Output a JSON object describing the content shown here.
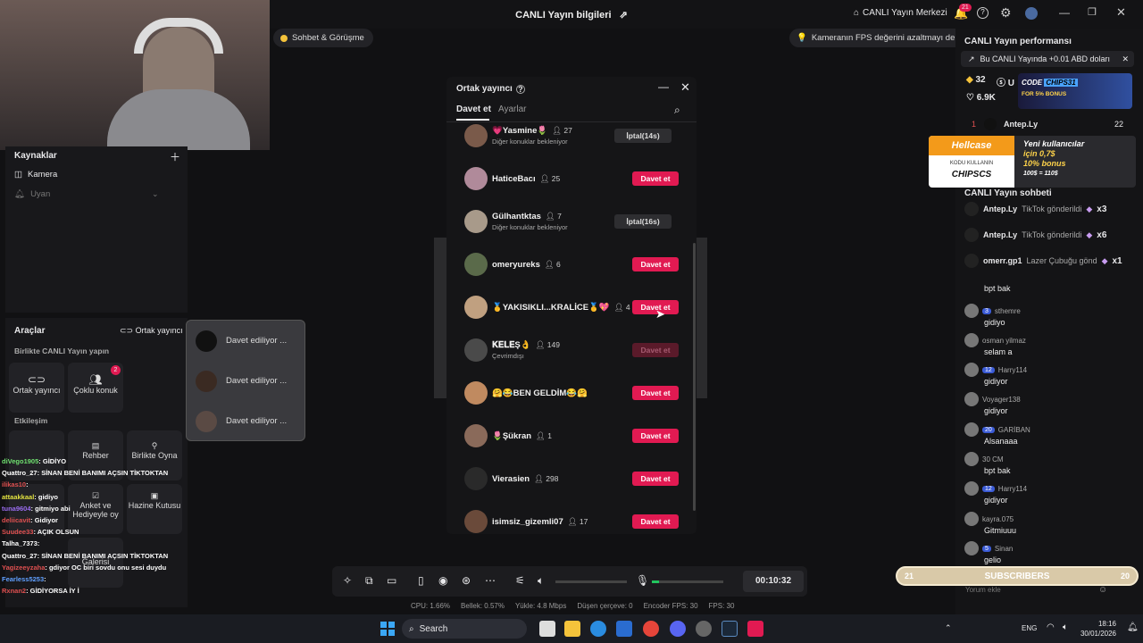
{
  "window": {
    "title": "CANLI Yayın bilgileri",
    "live_center": "CANLI Yayın Merkezi",
    "notif_count": "21"
  },
  "banners": {
    "chat_pill": "Sohbet & Görüşme",
    "fps_tip": "Kameranın FPS değerini azaltmayı deneyin"
  },
  "sources": {
    "title": "Kaynaklar",
    "items": [
      "Kamera",
      "Uyan"
    ]
  },
  "tools": {
    "title": "Araçlar",
    "cohost_link": "Ortak yayıncı",
    "section1": "Birlikte CANLI Yayın yapın",
    "btn_cohost": "Ortak yayıncı",
    "btn_multi": "Çoklu konuk",
    "multi_badge": "2",
    "section2": "Etkileşim",
    "btn_guide": "Rehber",
    "btn_play": "Birlikte Oyna",
    "btn_poll": "Anket ve Hediyeyle oy",
    "btn_treasure": "Hazine Kutusu",
    "btn_gallery": "Galerisi"
  },
  "invite_popup": {
    "items": [
      "Davet ediliyor ...",
      "Davet ediliyor ...",
      "Davet ediliyor ..."
    ]
  },
  "modal": {
    "title": "Ortak yayıncı",
    "tabs": [
      "Davet et",
      "Ayarlar"
    ],
    "rows": [
      {
        "name": "💗Yasmine🌷",
        "count": "27",
        "sub": "Diğer konuklar bekleniyor",
        "action": "İptal(14s)",
        "style": "gray"
      },
      {
        "name": "HaticeBacı",
        "count": "25",
        "sub": "",
        "action": "Davet et",
        "style": "red"
      },
      {
        "name": "Gülhantktas",
        "count": "7",
        "sub": "Diğer konuklar bekleniyor",
        "action": "İptal(16s)",
        "style": "gray"
      },
      {
        "name": "omeryureks",
        "count": "6",
        "sub": "",
        "action": "Davet et",
        "style": "red"
      },
      {
        "name": "🥇YAKISIKLI...KRALİCE🥇💖",
        "count": "4",
        "sub": "",
        "action": "Davet et",
        "style": "red"
      },
      {
        "name": "𝐊𝐄𝐋𝐄Ş👌",
        "count": "149",
        "sub": "Çevrimdışı",
        "action": "Davet et",
        "style": "dis"
      },
      {
        "name": "🤗😂BEN GELDİM😂🤗",
        "count": "",
        "sub": "",
        "action": "Davet et",
        "style": "red"
      },
      {
        "name": "🌷Şükran",
        "count": "1",
        "sub": "",
        "action": "Davet et",
        "style": "red"
      },
      {
        "name": "Vierasien",
        "count": "298",
        "sub": "",
        "action": "Davet et",
        "style": "red"
      },
      {
        "name": "isimsiz_gizemli07",
        "count": "17",
        "sub": "",
        "action": "Davet et",
        "style": "red"
      }
    ]
  },
  "player": {
    "timer": "00:10:32"
  },
  "stats": [
    "CPU: 1.66%",
    "Bellek: 0.57%",
    "Yükle: 4.8 Mbps",
    "Düşen çerçeve: 0",
    "Encoder FPS: 30",
    "FPS: 30"
  ],
  "performance": {
    "title": "CANLI Yayın performansı",
    "earn": "Bu CANLI Yayında +0.01 ABD doları",
    "stat1": "32",
    "stat2": "U",
    "stat3": "6.9K",
    "rank_num": "1",
    "rank_name": "Antep.Ly",
    "rank_val": "22"
  },
  "ads": {
    "code_label": "CODE",
    "code": "CHIPS31",
    "bonus": "FOR 5% BONUS",
    "hellcase": "Hellcase",
    "hc_code_label": "KODU KULLANIN",
    "hc_code": "CHIPSCS",
    "hc_text1": "Yeni kullanıcılar",
    "hc_text2": "için 0,7$",
    "hc_text3": "10% bonus",
    "hc_text4": "100$ = 110$"
  },
  "chat": {
    "title": "CANLI Yayın sohbeti",
    "gifts": [
      {
        "user": "Antep.Ly",
        "text": "TikTok gönderildi",
        "mult": "x3"
      },
      {
        "user": "Antep.Ly",
        "text": "TikTok gönderildi",
        "mult": "x6"
      },
      {
        "user": "omerr.gp1",
        "text": "Lazer Çubuğu gönd",
        "mult": "x1"
      }
    ],
    "messages": [
      {
        "user": "",
        "lvl": "",
        "text": "bpt bak"
      },
      {
        "user": "sthemre",
        "lvl": "3",
        "text": "gidiyo"
      },
      {
        "user": "osman yilmaz",
        "lvl": "",
        "text": "selam a"
      },
      {
        "user": "Harry114",
        "lvl": "12",
        "text": "gidiyor"
      },
      {
        "user": "Voyager138",
        "lvl": "",
        "text": "gidiyor"
      },
      {
        "user": "GARİBAN",
        "lvl": "20",
        "text": "Alsanaaa"
      },
      {
        "user": "30 CM",
        "lvl": "",
        "text": "bpt bak"
      },
      {
        "user": "Harry114",
        "lvl": "12",
        "text": "gidiyor"
      },
      {
        "user": "kayra.075",
        "lvl": "",
        "text": "Gitmiuuu"
      },
      {
        "user": "Sinan",
        "lvl": "5",
        "text": "gelio"
      }
    ],
    "input_placeholder": "Yorum ekle",
    "sub_bar": {
      "left": "21",
      "label": "SUBSCRIBERS",
      "right": "20"
    }
  },
  "overlay_chat": [
    {
      "u": "diVego1905",
      "t": ": GİDİYO",
      "c": "#6fe06f"
    },
    {
      "u": "Quattro_27",
      "t": ": SİNAN BENİ BANIMI AÇSIN TİKTOKTAN",
      "c": "#ffffff"
    },
    {
      "u": "ilikas10",
      "t": ":",
      "c": "#e05050"
    },
    {
      "u": "attaakkaal",
      "t": ": gidiyo",
      "c": "#e0e040"
    },
    {
      "u": "tuna9604",
      "t": ": gitmiyo abi",
      "c": "#9a6cf0"
    },
    {
      "u": "deliicavit",
      "t": ": Gidiyor",
      "c": "#e05050"
    },
    {
      "u": "Suudee33",
      "t": ": AÇIK OLSUN",
      "c": "#e05050"
    },
    {
      "u": "Talha_7373",
      "t": ":",
      "c": "#ffffff"
    },
    {
      "u": "Quattro_27",
      "t": ": SİNAN BENİ BANIMI AÇSIN TİKTOKTAN",
      "c": "#ffffff"
    },
    {
      "u": "Yagizeeyzaha",
      "t": ": gdiyor OC biri sovdu onu sesi duydu",
      "c": "#e05050"
    },
    {
      "u": "Fearless5253",
      "t": ":",
      "c": "#60a0ff"
    },
    {
      "u": "Rxnan2",
      "t": ": GİDİYORSA İY İ",
      "c": "#e05050"
    }
  ],
  "taskbar": {
    "search": "Search",
    "lang": "ENG",
    "time": "18:16",
    "date": "30/01/2026"
  }
}
